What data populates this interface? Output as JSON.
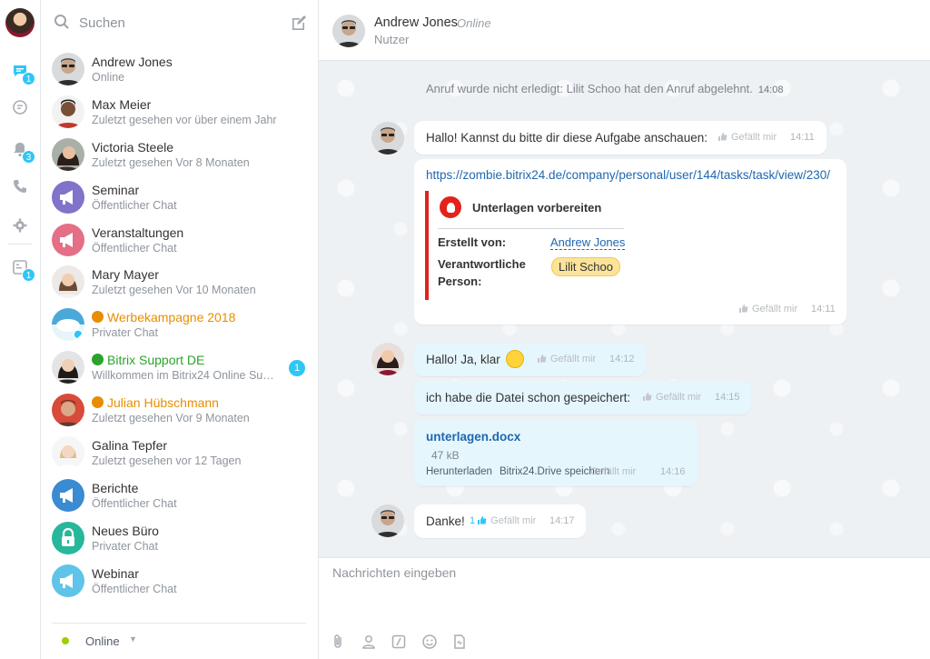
{
  "rail": {
    "chat_badge": "1",
    "notif_badge": "3",
    "tasks_badge": "1"
  },
  "search": {
    "placeholder": "Suchen"
  },
  "contacts": [
    {
      "name": "Andrew Jones",
      "sub": "Online",
      "avatar": "photo-glasses",
      "style": ""
    },
    {
      "name": "Max Meier",
      "sub": "Zuletzt gesehen vor über einem Jahr",
      "avatar": "photo-dark",
      "style": ""
    },
    {
      "name": "Victoria Steele",
      "sub": "Zuletzt gesehen Vor 8 Monaten",
      "avatar": "photo-woman",
      "style": ""
    },
    {
      "name": "Seminar",
      "sub": "Öffentlicher Chat",
      "avatar": "megaphone-purple",
      "style": ""
    },
    {
      "name": "Veranstaltungen",
      "sub": "Öffentlicher Chat",
      "avatar": "megaphone-pink",
      "style": ""
    },
    {
      "name": "Mary Mayer",
      "sub": "Zuletzt gesehen Vor 10 Monaten",
      "avatar": "photo-woman2",
      "style": ""
    },
    {
      "name": "Werbekampagne 2018",
      "sub": "Privater Chat",
      "avatar": "cloud",
      "style": "orange"
    },
    {
      "name": "Bitrix Support DE",
      "sub": "Willkommen im Bitrix24 Online Supp...",
      "avatar": "photo-woman3",
      "style": "green",
      "badge": "1"
    },
    {
      "name": "Julian Hübschmann",
      "sub": "Zuletzt gesehen Vor 9 Monaten",
      "avatar": "photo-man",
      "style": "orange"
    },
    {
      "name": "Galina Tepfer",
      "sub": "Zuletzt gesehen vor 12 Tagen",
      "avatar": "photo-woman4",
      "style": ""
    },
    {
      "name": "Berichte",
      "sub": "Öffentlicher Chat",
      "avatar": "megaphone-blue",
      "style": ""
    },
    {
      "name": "Neues Büro",
      "sub": "Privater Chat",
      "avatar": "lock-teal",
      "style": ""
    },
    {
      "name": "Webinar",
      "sub": "Öffentlicher Chat",
      "avatar": "megaphone-lightblue",
      "style": ""
    }
  ],
  "status": {
    "label": "Online"
  },
  "chat": {
    "name": "Andrew Jones",
    "status": "Online",
    "role": "Nutzer"
  },
  "messages": {
    "system": {
      "text": "Anruf wurde nicht erledigt: Lilit Schoo hat den Anruf abgelehnt.",
      "time": "14:08"
    },
    "m1": {
      "text": "Hallo! Kannst du bitte dir diese Aufgabe anschauen:",
      "like": "Gefällt mir",
      "time": "14:11"
    },
    "m2": {
      "link": "https://zombie.bitrix24.de/company/personal/user/144/tasks/task/view/230/",
      "task_title": "Unterlagen vorbereiten",
      "created_by_label": "Erstellt von:",
      "created_by": "Andrew Jones",
      "responsible_label_1": "Verantwortliche",
      "responsible_label_2": "Person:",
      "responsible": "Lilit Schoo",
      "like": "Gefällt mir",
      "time": "14:11"
    },
    "m3": {
      "text": "Hallo! Ja, klar",
      "like": "Gefällt mir",
      "time": "14:12"
    },
    "m4": {
      "text": "ich habe die Datei schon gespeichert:",
      "like": "Gefällt mir",
      "time": "14:15"
    },
    "m5": {
      "file_name": "unterlagen.docx",
      "file_size": "47 kB",
      "download": "Herunterladen",
      "drive": "Bitrix24.Drive speichern",
      "like": "Gefällt mir",
      "time": "14:16"
    },
    "m6": {
      "text": "Danke!",
      "like_count": "1",
      "like": "Gefällt mir",
      "time": "14:17"
    }
  },
  "composer": {
    "placeholder": "Nachrichten eingeben"
  },
  "colors": {
    "accent": "#2fc6f6",
    "task_red": "#e2221b",
    "link": "#2067b0",
    "online": "#9dcf00"
  }
}
